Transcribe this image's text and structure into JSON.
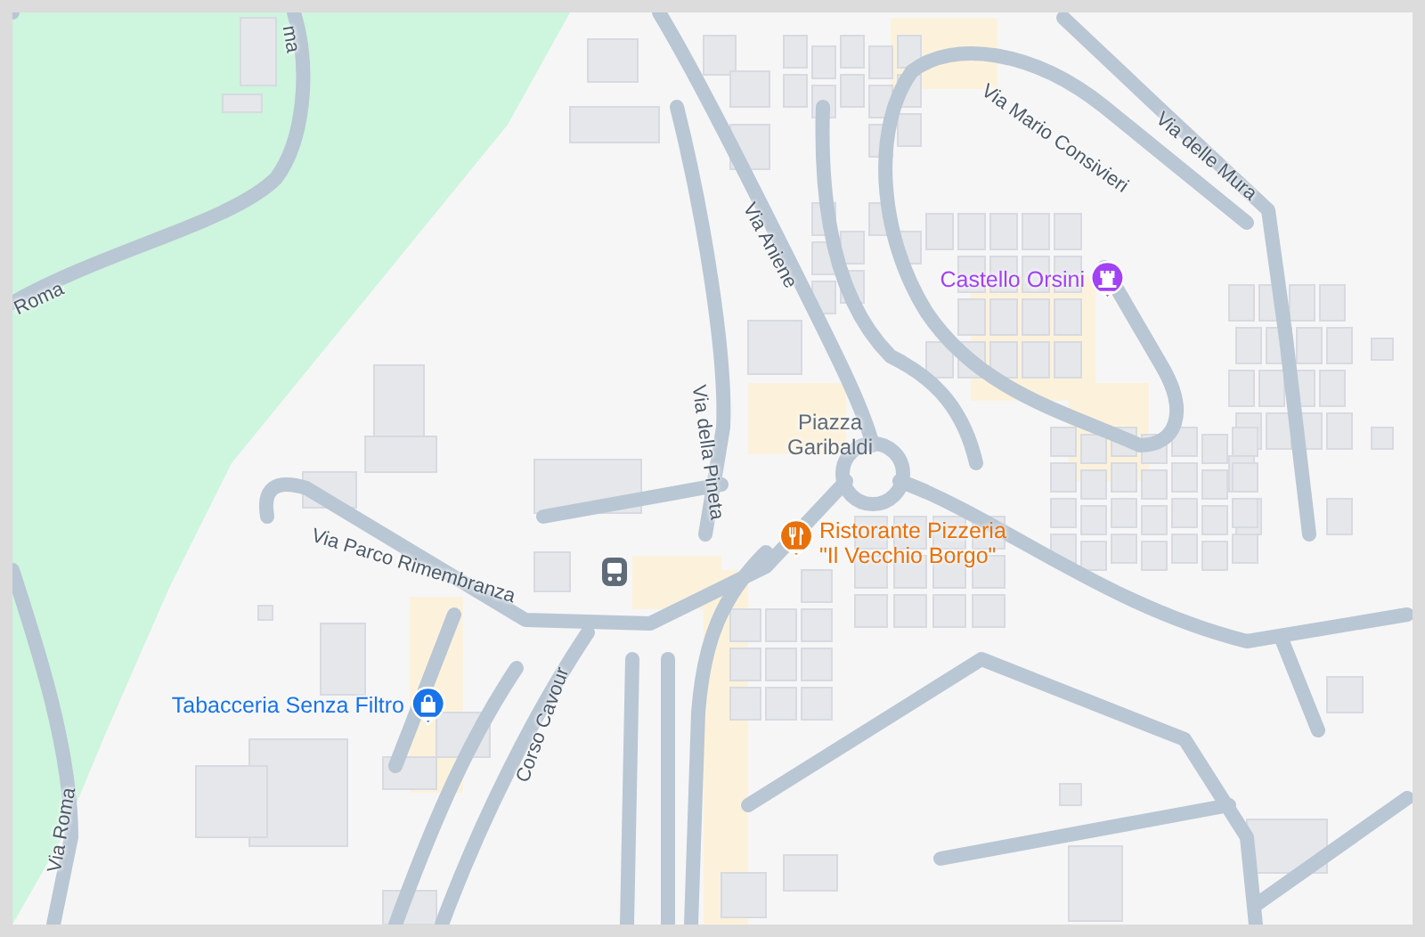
{
  "map": {
    "street_labels": [
      {
        "text": "ma"
      },
      {
        "text": "Roma"
      },
      {
        "text": "Via Roma"
      },
      {
        "text": "Via Aniene"
      },
      {
        "text": "Via della Pineta"
      },
      {
        "text": "Via Mario Consivieri"
      },
      {
        "text": "Via delle Mura"
      },
      {
        "text": "Via Parco Rimembranza"
      },
      {
        "text": "Corso Cavour"
      }
    ],
    "place_labels": [
      {
        "lines": [
          "Piazza",
          "Garibaldi"
        ]
      }
    ],
    "pois": [
      {
        "kind": "castle",
        "lines": [
          "Castello Orsini"
        ],
        "color": "#a142f4"
      },
      {
        "kind": "restaurant",
        "lines": [
          "Ristorante Pizzeria",
          "\"Il Vecchio Borgo\""
        ],
        "color": "#e8710a"
      },
      {
        "kind": "shop",
        "lines": [
          "Tabacceria Senza Filtro"
        ],
        "color": "#1a73e8"
      }
    ]
  }
}
